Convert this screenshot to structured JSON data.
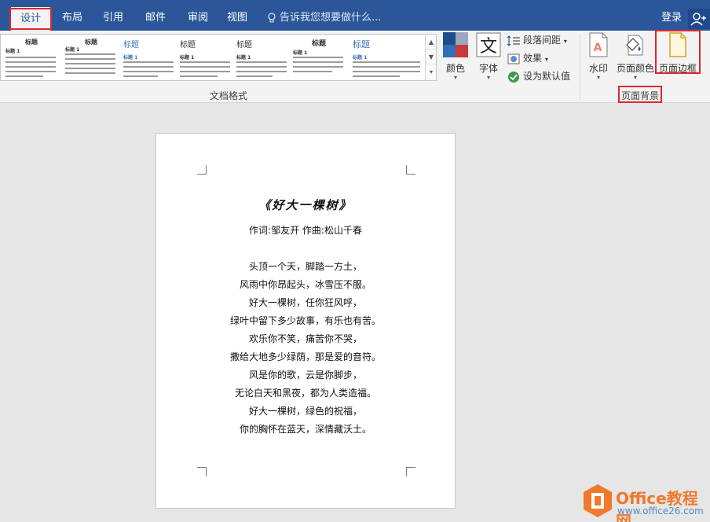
{
  "tabs": [
    {
      "label": "设计",
      "active": true
    },
    {
      "label": "布局",
      "active": false
    },
    {
      "label": "引用",
      "active": false
    },
    {
      "label": "邮件",
      "active": false
    },
    {
      "label": "审阅",
      "active": false
    },
    {
      "label": "视图",
      "active": false
    }
  ],
  "tell_me": "告诉我您想要做什么...",
  "login": "登录",
  "gallery": {
    "thumbs": [
      {
        "title": "标题",
        "heading": "标题 1"
      },
      {
        "title": "标题",
        "heading": "标题 1"
      },
      {
        "title": "标题",
        "heading": "标题 1"
      },
      {
        "title": "标题",
        "heading": "标题 1"
      },
      {
        "title": "标题",
        "heading": "标题 1"
      },
      {
        "title": "标题",
        "heading": "标题 1"
      },
      {
        "title": "标题",
        "heading": "标题 1"
      }
    ]
  },
  "groups": {
    "doc_format": "文档格式",
    "page_background": "页面背景"
  },
  "buttons": {
    "colors": "颜色",
    "fonts": "字体",
    "paragraph_spacing": "段落间距",
    "effects": "效果",
    "set_default": "设为默认值",
    "watermark": "水印",
    "page_color": "页面颜色",
    "page_borders": "页面边框"
  },
  "document": {
    "title": "《好大一棵树》",
    "credits": "作词:邹友开    作曲:松山千春",
    "lyrics": [
      "头顶一个天，脚踏一方土，",
      "风雨中你昂起头，冰雪压不服。",
      "好大一棵树，任你狂风呼，",
      "绿叶中留下多少故事，有乐也有苦。",
      "欢乐你不笑，痛苦你不哭，",
      "撒给大地多少绿荫，那是爱的音符。",
      "风是你的歌，云是你脚步，",
      "无论白天和黑夜，都为人类造福。",
      "好大一棵树，绿色的祝福，",
      "你的胸怀在蓝天，深情藏沃土。"
    ]
  },
  "watermark": {
    "name": "Office教程网",
    "url": "www.office26.com"
  },
  "colors": {
    "ribbon_blue": "#2b579a",
    "highlight_red": "#e0262e",
    "logo_orange": "#f0792b"
  }
}
